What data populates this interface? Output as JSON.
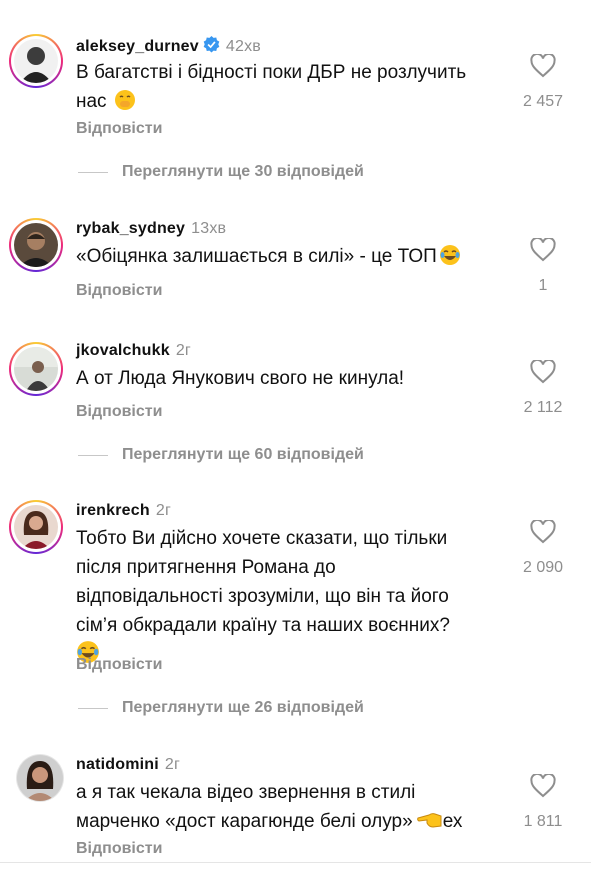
{
  "comments": [
    {
      "username": "aleksey_durnev",
      "verified": true,
      "time": "42хв",
      "text": "В багатстві і бідності поки ДБР не розлучить нас",
      "text_line1": "В багатстві і бідності поки ДБР не розлучить",
      "text_line2": "нас",
      "reply": "Відповісти",
      "likes": "2 457",
      "more_replies": "Переглянути ще 30 відповідей"
    },
    {
      "username": "rybak_sydney",
      "verified": false,
      "time": "13хв",
      "text": "«Обіцянка залишається в силі» - це ТОП",
      "reply": "Відповісти",
      "likes": "1"
    },
    {
      "username": "jkovalchukk",
      "verified": false,
      "time": "2г",
      "text": "А от Люда Янукович свого не кинула!",
      "reply": "Відповісти",
      "likes": "2 112",
      "more_replies": "Переглянути ще 60 відповідей"
    },
    {
      "username": "irenkrech",
      "verified": false,
      "time": "2г",
      "text_line1": "Тобто Ви дійсно хочете сказати, що тільки",
      "text_line2": "після притягнення Романа до",
      "text_line3": "відповідальності зрозуміли, що він та його",
      "text_line4": "сім’я обкрадали країну та наших воєнних?",
      "reply": "Відповісти",
      "likes": "2 090",
      "more_replies": "Переглянути ще 26 відповідей"
    },
    {
      "username": "natidomini",
      "verified": false,
      "time": "2г",
      "text_line1": "а я так чекала відео звернення в стилі",
      "text_line2": "марченко «дост карагюнде белі олур»",
      "text_tail": "ех",
      "reply": "Відповісти",
      "likes": "1 811"
    }
  ],
  "icons": {
    "like": "heart-outline-icon",
    "verified": "verified-badge-icon",
    "emoji_shush": "face-with-hand-over-mouth-emoji",
    "emoji_laugh": "face-with-tears-of-joy-emoji",
    "emoji_point": "backhand-index-pointing-left-emoji"
  },
  "colors": {
    "text": "#111111",
    "muted": "#8e8e8e",
    "verified": "#3897f0"
  }
}
